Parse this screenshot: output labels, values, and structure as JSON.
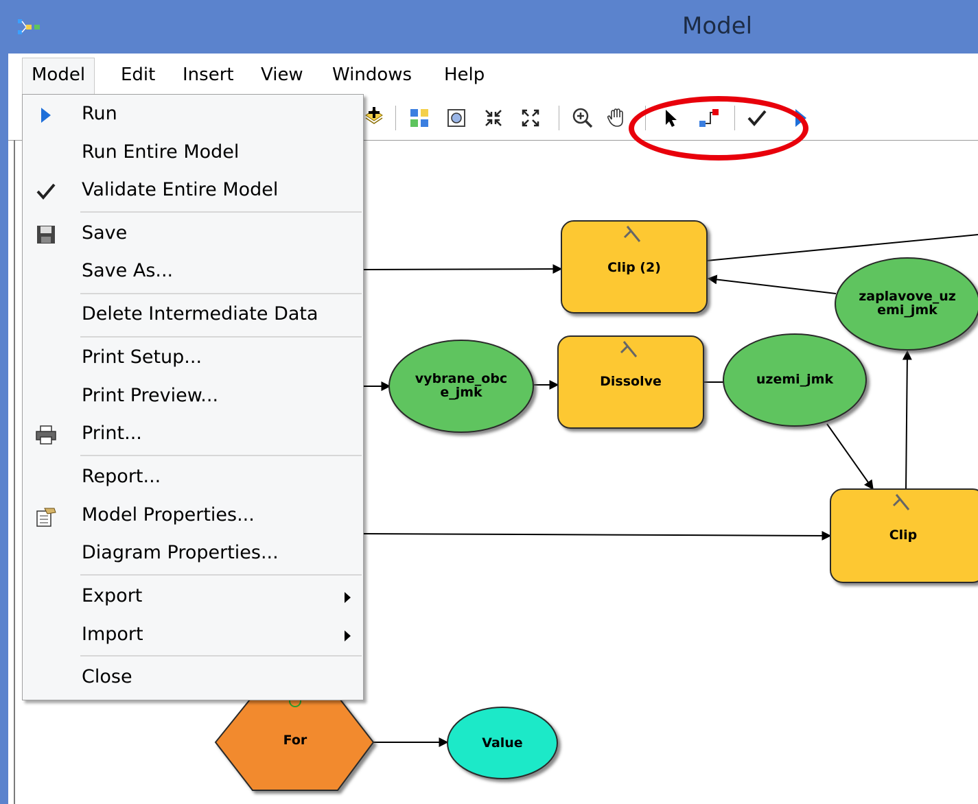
{
  "window": {
    "title": "Model"
  },
  "menubar": {
    "items": [
      {
        "label": "Model"
      },
      {
        "label": "Edit"
      },
      {
        "label": "Insert"
      },
      {
        "label": "View"
      },
      {
        "label": "Windows"
      },
      {
        "label": "Help"
      }
    ]
  },
  "model_menu": {
    "items": [
      {
        "label": "Run",
        "icon": "run-icon"
      },
      {
        "label": "Run Entire Model",
        "icon": ""
      },
      {
        "label": "Validate Entire Model",
        "icon": "check-icon"
      },
      {
        "label": "Save",
        "icon": "save-icon"
      },
      {
        "label": "Save As...",
        "icon": ""
      },
      {
        "label": "Delete Intermediate Data",
        "icon": ""
      },
      {
        "label": "Print Setup...",
        "icon": ""
      },
      {
        "label": "Print Preview...",
        "icon": ""
      },
      {
        "label": "Print...",
        "icon": "printer-icon"
      },
      {
        "label": "Report...",
        "icon": ""
      },
      {
        "label": "Model Properties...",
        "icon": "properties-icon"
      },
      {
        "label": "Diagram Properties...",
        "icon": ""
      },
      {
        "label": "Export",
        "icon": "",
        "submenu": true
      },
      {
        "label": "Import",
        "icon": "",
        "submenu": true
      },
      {
        "label": "Close",
        "icon": ""
      }
    ]
  },
  "diagram": {
    "nodes": [
      {
        "label": "Clip (2)",
        "kind": "tool"
      },
      {
        "label": "Dissolve",
        "kind": "tool"
      },
      {
        "label": "Clip",
        "kind": "tool"
      },
      {
        "label": "vybrane_obc",
        "label2": "e_jmk",
        "kind": "data"
      },
      {
        "label": "uzemi_jmk",
        "kind": "data"
      },
      {
        "label": "zaplavove_uz",
        "label2": "emi_jmk",
        "kind": "data"
      },
      {
        "label": "For",
        "kind": "iterator"
      },
      {
        "label": "Value",
        "kind": "variable"
      }
    ]
  },
  "colors": {
    "titlebar": "#5b83cd",
    "tool": "#fdc830",
    "data": "#5ec45e",
    "iterator": "#f28a2e",
    "variable": "#1de9c8",
    "highlight": "#e8000b"
  }
}
